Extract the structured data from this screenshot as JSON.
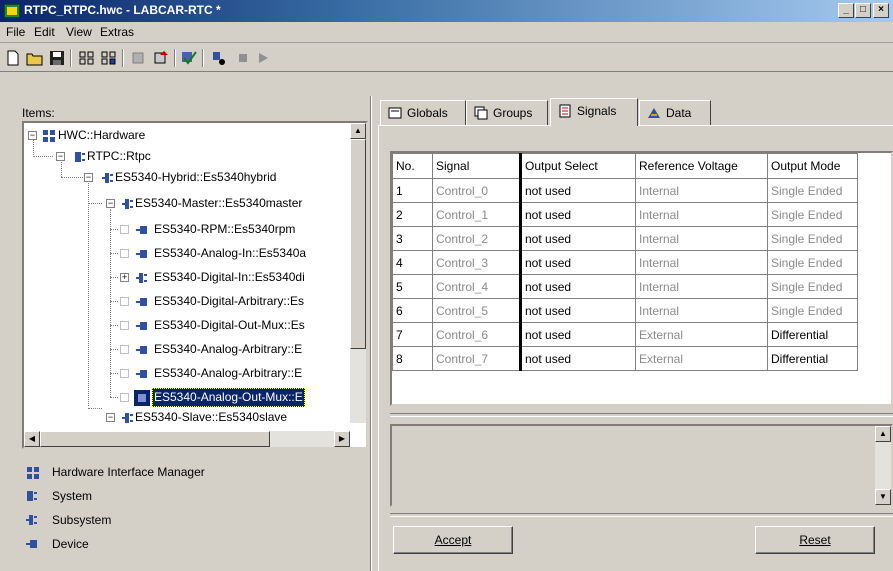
{
  "window": {
    "title": "RTPC_RTPC.hwc - LABCAR-RTC  *",
    "minimize": "_",
    "maximize": "□",
    "close": "×"
  },
  "menu": [
    "File",
    "Edit",
    "View",
    "Extras"
  ],
  "left": {
    "items_label": "Items:",
    "tree": [
      "HWC::Hardware",
      "RTPC::Rtpc",
      "ES5340-Hybrid::Es5340hybrid",
      "ES5340-Master::Es5340master",
      "ES5340-RPM::Es5340rpm",
      "ES5340-Analog-In::Es5340a",
      "ES5340-Digital-In::Es5340di",
      "ES5340-Digital-Arbitrary::Es",
      "ES5340-Digital-Out-Mux::Es",
      "ES5340-Analog-Arbitrary::E",
      "ES5340-Analog-Arbitrary::E",
      "ES5340-Analog-Out-Mux::E",
      "ES5340-Slave::Es5340slave"
    ],
    "legend": [
      "Hardware Interface Manager",
      "System",
      "Subsystem",
      "Device"
    ]
  },
  "tabs": [
    "Globals",
    "Groups",
    "Signals",
    "Data"
  ],
  "active_tab": "Signals",
  "signals_table": {
    "headers": [
      "No.",
      "Signal",
      "Output Select",
      "Reference Voltage",
      "Output Mode"
    ],
    "rows": [
      [
        "1",
        "Control_0",
        "not used",
        "Internal",
        "Single Ended"
      ],
      [
        "2",
        "Control_1",
        "not used",
        "Internal",
        "Single Ended"
      ],
      [
        "3",
        "Control_2",
        "not used",
        "Internal",
        "Single Ended"
      ],
      [
        "4",
        "Control_3",
        "not used",
        "Internal",
        "Single Ended"
      ],
      [
        "5",
        "Control_4",
        "not used",
        "Internal",
        "Single Ended"
      ],
      [
        "6",
        "Control_5",
        "not used",
        "Internal",
        "Single Ended"
      ],
      [
        "7",
        "Control_6",
        "not used",
        "External",
        "Differential"
      ],
      [
        "8",
        "Control_7",
        "not used",
        "External",
        "Differential"
      ]
    ]
  },
  "buttons": {
    "accept": "Accept",
    "reset": "Reset"
  }
}
